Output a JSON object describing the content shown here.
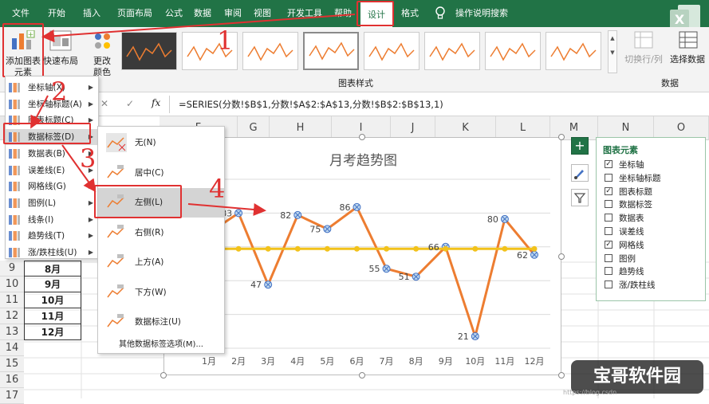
{
  "tabs": [
    "文件",
    "开始",
    "插入",
    "页面布局",
    "公式",
    "数据",
    "审阅",
    "视图",
    "开发工具",
    "帮助",
    "设计",
    "格式"
  ],
  "tell_me": "操作说明搜索",
  "ribbon": {
    "add_element": [
      "添加图表",
      "元素"
    ],
    "quick_layout": "快速布局",
    "change_colors": [
      "更改",
      "颜色"
    ],
    "chart_styles_label": "图表样式",
    "switch_row_col": "切换行/列",
    "select_data": "选择数据",
    "data_group_label": "数据"
  },
  "formula": {
    "cancel": "✕",
    "enter": "✓",
    "fx": "fx",
    "value": "=SERIES(分数!$B$1,分数!$A$2:$A$13,分数!$B$2:$B$13,1)"
  },
  "columns": [
    "F",
    "G",
    "H",
    "I",
    "J",
    "K",
    "L",
    "M",
    "N",
    "O"
  ],
  "rows": [
    {
      "num": "9",
      "a": "8月"
    },
    {
      "num": "10",
      "a": "9月"
    },
    {
      "num": "11",
      "a": "10月"
    },
    {
      "num": "12",
      "a": "11月"
    },
    {
      "num": "13",
      "a": "12月"
    },
    {
      "num": "14",
      "a": ""
    },
    {
      "num": "15",
      "a": ""
    },
    {
      "num": "16",
      "a": ""
    },
    {
      "num": "17",
      "a": ""
    }
  ],
  "main_menu": [
    {
      "label": "坐标轴(X)",
      "arrow": true
    },
    {
      "label": "坐标轴标题(A)",
      "arrow": true
    },
    {
      "label": "图表标题(C)",
      "arrow": true
    },
    {
      "label": "数据标签(D)",
      "arrow": true
    },
    {
      "label": "数据表(B)",
      "arrow": true
    },
    {
      "label": "误差线(E)",
      "arrow": true
    },
    {
      "label": "网格线(G)",
      "arrow": true
    },
    {
      "label": "图例(L)",
      "arrow": true
    },
    {
      "label": "线条(I)",
      "arrow": true
    },
    {
      "label": "趋势线(T)",
      "arrow": true
    },
    {
      "label": "涨/跌柱线(U)",
      "arrow": true
    }
  ],
  "sub_menu": [
    {
      "label": "无(N)"
    },
    {
      "label": "居中(C)"
    },
    {
      "label": "左侧(L)"
    },
    {
      "label": "右侧(R)"
    },
    {
      "label": "上方(A)"
    },
    {
      "label": "下方(W)"
    },
    {
      "label": "数据标注(U)"
    }
  ],
  "sub_menu_more": "其他数据标签选项(M)...",
  "annotations": [
    "1",
    "2",
    "3",
    "4"
  ],
  "chart_panel": {
    "title": "图表元素",
    "items": [
      {
        "label": "坐标轴",
        "checked": true
      },
      {
        "label": "坐标轴标题",
        "checked": false
      },
      {
        "label": "图表标题",
        "checked": true
      },
      {
        "label": "数据标签",
        "checked": false
      },
      {
        "label": "数据表",
        "checked": false
      },
      {
        "label": "误差线",
        "checked": false
      },
      {
        "label": "网格线",
        "checked": true
      },
      {
        "label": "图例",
        "checked": false
      },
      {
        "label": "趋势线",
        "checked": false
      },
      {
        "label": "涨/跌柱线",
        "checked": false
      }
    ]
  },
  "watermark": "宝哥软件园",
  "watermark_small": "https://blog.csdn",
  "chart_data": {
    "type": "line",
    "title": "月考趋势图",
    "categories": [
      "1月",
      "2月",
      "3月",
      "4月",
      "5月",
      "6月",
      "7月",
      "8月",
      "9月",
      "10月",
      "11月",
      "12月"
    ],
    "series": [
      {
        "values": [
          73,
          83,
          47,
          82,
          75,
          86,
          55,
          51,
          66,
          21,
          80,
          62
        ],
        "color": "#ed7d31"
      },
      {
        "values": [
          65,
          65,
          65,
          65,
          65,
          65,
          65,
          65,
          65,
          65,
          65,
          65
        ],
        "color": "#f2c21b"
      }
    ],
    "visible_labels": [
      "",
      "83",
      "47",
      "82",
      "75",
      "86",
      "55",
      "51",
      "66",
      "21",
      "80",
      "62"
    ],
    "ylim": [
      15,
      100
    ],
    "grid": true
  }
}
